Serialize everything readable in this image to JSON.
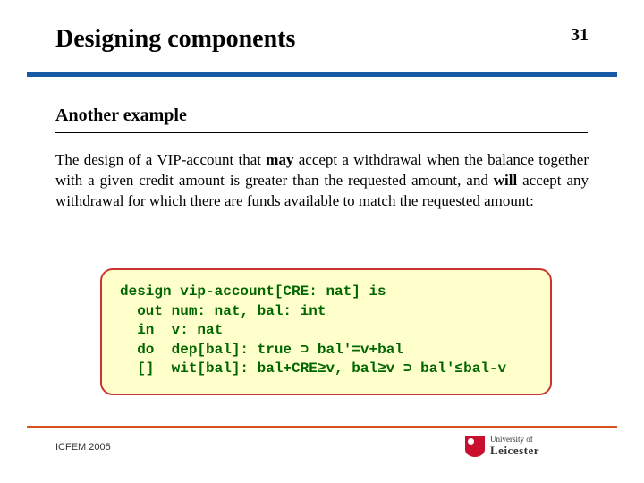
{
  "header": {
    "title": "Designing components",
    "page_number": "31"
  },
  "subheading": "Another example",
  "body": {
    "pre1": "The design of a VIP-account that ",
    "may": "may",
    "mid1": " accept a withdrawal when the balance together with a given credit amount is greater than the requested amount, and ",
    "will": "will",
    "post1": " accept any withdrawal for which there are funds available to match the requested amount:"
  },
  "code": {
    "l1": "design vip-account[CRE: nat] is",
    "l2": "  out num: nat, bal: int",
    "l3": "  in  v: nat",
    "l4a": "  do  dep[bal]: true ",
    "l4b": " bal'=v+bal",
    "l5a": "  []  wit[bal]: bal+CRE≥v, bal≥v ",
    "l5b": " bal'≤bal-v",
    "arrow": "⊃"
  },
  "footer": {
    "left": "ICFEM 2005",
    "logo_top": "University of",
    "logo_bottom": "Leicester"
  }
}
